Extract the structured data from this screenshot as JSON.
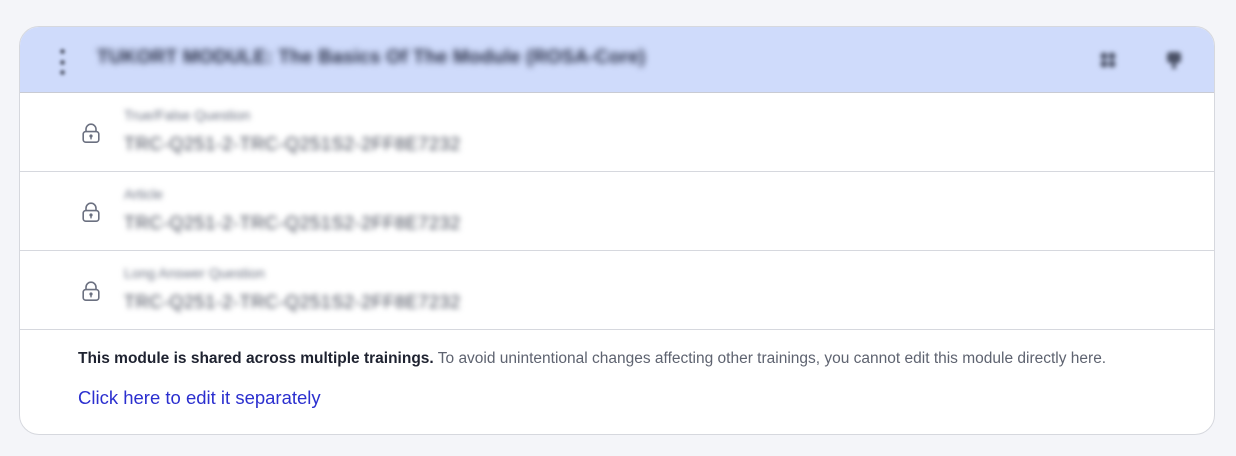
{
  "module": {
    "title": "TUKORT MODULE: The Basics Of The Module (ROSA-Core)",
    "action_icons": [
      "settings-icon",
      "help-icon"
    ]
  },
  "items": [
    {
      "type": "True/False Question",
      "id": "TRC-Q251-2-TRC-Q251S2-2FF8E7232",
      "icon": "lock-icon"
    },
    {
      "type": "Article",
      "id": "TRC-Q251-2-TRC-Q251S2-2FF8E7232",
      "icon": "lock-icon"
    },
    {
      "type": "Long Answer Question",
      "id": "TRC-Q251-2-TRC-Q251S2-2FF8E7232",
      "icon": "lock-icon"
    }
  ],
  "notice": {
    "bold": "This module is shared across multiple trainings.",
    "text": " To avoid unintentional changes affecting other trainings, you cannot edit this module directly here."
  },
  "edit_link": {
    "label": "Click here to edit it separately"
  },
  "colors": {
    "header_bg": "#cfdbfb",
    "link": "#2b2fcf",
    "page_bg": "#f4f5f9"
  }
}
